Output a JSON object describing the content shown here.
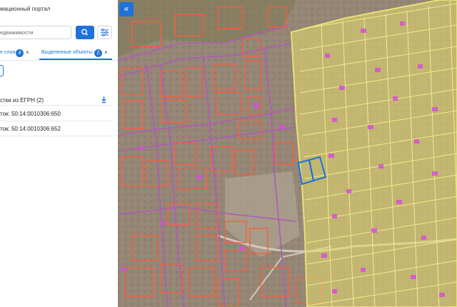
{
  "panel": {
    "portal_title": "мационный портал",
    "search_placeholder": "едвижимости",
    "tabs": [
      {
        "label": "е слои",
        "count": "4"
      },
      {
        "label": "Выделенные объекты",
        "count": "2"
      }
    ],
    "close_glyph": "×",
    "group_title": "стки из ЕГРН (2)",
    "items": [
      {
        "label": "ток: 50:14:0010306:650"
      },
      {
        "label": "ток: 50:14:0010306:652"
      }
    ]
  },
  "map": {
    "collapse_glyph": "«",
    "colors": {
      "parcel_outline": "#ff5a3c",
      "zone_outline": "#e9e07a",
      "selected_outline": "#1e72d9",
      "road_outline": "#b05ab8",
      "building": "#d84fd8"
    },
    "icons": [
      "search-icon",
      "filter-icon",
      "download-icon",
      "double-chevron-left-icon",
      "close-icon"
    ]
  }
}
